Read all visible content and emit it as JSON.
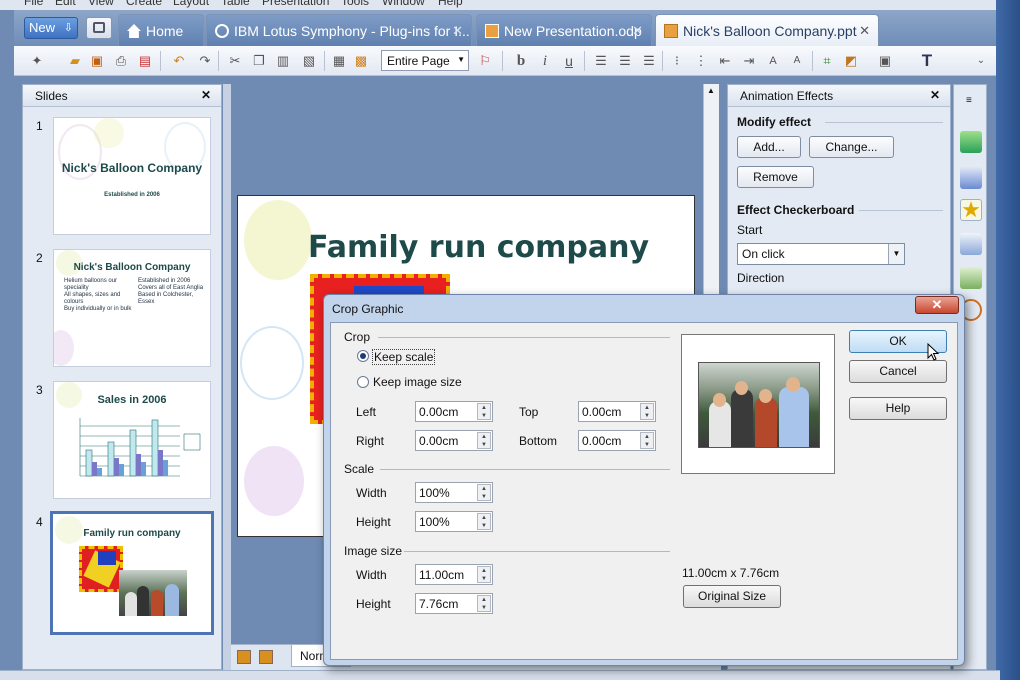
{
  "menu": [
    "File",
    "Edit",
    "View",
    "Create",
    "Layout",
    "Table",
    "Presentation",
    "Tools",
    "Window",
    "Help"
  ],
  "tabbar": {
    "new_label": "New",
    "tabs": [
      {
        "label": "Home",
        "icon": "home-icon"
      },
      {
        "label": "IBM Lotus Symphony - Plug-ins for I...",
        "icon": "globe-icon",
        "closable": true
      },
      {
        "label": "New Presentation.odp",
        "icon": "presentation-icon",
        "closable": true
      },
      {
        "label": "Nick's Balloon Company.ppt",
        "icon": "presentation-icon",
        "closable": true,
        "active": true
      }
    ]
  },
  "toolbar": {
    "zoom": "Entire Page"
  },
  "slides_panel": {
    "title": "Slides",
    "slides": [
      {
        "number": "1",
        "title": "Nick's Balloon Company",
        "subtitle": "Established in 2006"
      },
      {
        "number": "2",
        "title": "Nick's Balloon Company",
        "bullets_left": [
          "Helium balloons our speciality",
          "All shapes, sizes and colours",
          "Buy individually or in bulk"
        ],
        "bullets_right": [
          "Established in 2006",
          "Covers all of East Anglia",
          "Based in Colchester, Essex"
        ]
      },
      {
        "number": "3",
        "title": "Sales in 2006"
      },
      {
        "number": "4",
        "title": "Family run company",
        "selected": true
      }
    ]
  },
  "slide": {
    "title": "Family run company",
    "view_tab": "Norm"
  },
  "animation_panel": {
    "title": "Animation Effects",
    "modify_effect": "Modify effect",
    "add_label": "Add...",
    "change_label": "Change...",
    "remove_label": "Remove",
    "effect_name": "Effect Checkerboard",
    "start_label": "Start",
    "start_value": "On click",
    "direction_label": "Direction"
  },
  "dialog": {
    "title": "Crop Graphic",
    "close_glyph": "✕",
    "crop_group": "Crop",
    "keep_scale": "Keep scale",
    "keep_image_size": "Keep image size",
    "left_label": "Left",
    "left_value": "0.00cm",
    "right_label": "Right",
    "right_value": "0.00cm",
    "top_label": "Top",
    "top_value": "0.00cm",
    "bottom_label": "Bottom",
    "bottom_value": "0.00cm",
    "scale_group": "Scale",
    "scale_width_label": "Width",
    "scale_width_value": "100%",
    "scale_height_label": "Height",
    "scale_height_value": "100%",
    "size_group": "Image size",
    "size_width_label": "Width",
    "size_width_value": "11.00cm",
    "size_height_label": "Height",
    "size_height_value": "7.76cm",
    "original_dims": "11.00cm x 7.76cm",
    "original_size_label": "Original Size",
    "ok_label": "OK",
    "cancel_label": "Cancel",
    "help_label": "Help"
  },
  "colors": {
    "accent": "#3e72c2",
    "title_text": "#1e4a4a",
    "chrome": "#6f8bb3"
  }
}
